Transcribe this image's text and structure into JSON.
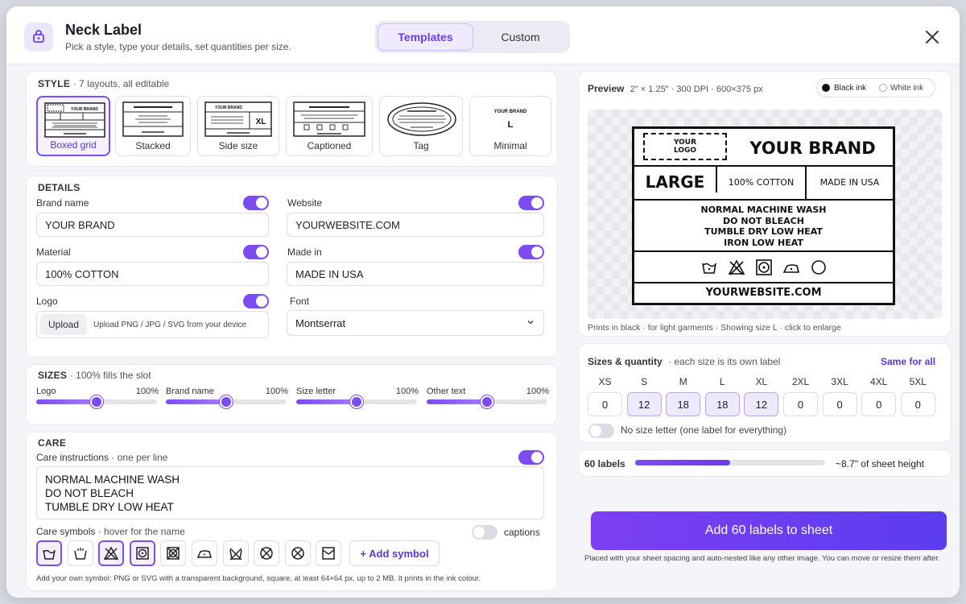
{
  "header": {
    "title": "Neck Label",
    "subtitle": "Pick a style, type your details, set quantities per size.",
    "tabs": [
      "Templates",
      "Custom"
    ],
    "active_tab": "Templates"
  },
  "style": {
    "title": "STYLE",
    "note": "· 7 layouts, all editable",
    "layouts": [
      "Boxed grid",
      "Stacked",
      "Side size",
      "Captioned",
      "Tag",
      "Minimal"
    ],
    "selected": "Boxed grid",
    "thumb_brand": "YOUR BRAND",
    "thumb_size": "XL",
    "thumb_minimal_size": "L"
  },
  "details": {
    "title": "DETAILS",
    "brand_label": "Brand name",
    "brand_value": "YOUR BRAND",
    "website_label": "Website",
    "website_value": "YOURWEBSITE.COM",
    "material_label": "Material",
    "material_value": "100% COTTON",
    "made_in_label": "Made in",
    "made_in_value": "MADE IN USA",
    "logo_label": "Logo",
    "upload_button": "Upload",
    "upload_hint": "Upload PNG / JPG / SVG from your device",
    "font_label": "Font",
    "font_value": "Montserrat",
    "toggles_on": true
  },
  "sizes": {
    "title": "SIZES",
    "note": "· 100% fills the slot",
    "sliders": [
      {
        "label": "Logo",
        "value": "100%",
        "level": 0.5
      },
      {
        "label": "Brand name",
        "value": "100%",
        "level": 0.5
      },
      {
        "label": "Size letter",
        "value": "100%",
        "level": 0.5
      },
      {
        "label": "Other text",
        "value": "100%",
        "level": 0.5
      }
    ]
  },
  "care": {
    "title": "CARE",
    "instructions_label": "Care instructions",
    "instructions_note": "· one per line",
    "instructions": [
      "NORMAL MACHINE WASH",
      "DO NOT BLEACH",
      "TUMBLE DRY LOW HEAT"
    ],
    "symbols_label": "Care symbols",
    "symbols_note": "· hover for the name",
    "captions_label": "captions",
    "add_symbol": "+ Add symbol",
    "hint": "Add your own symbol: PNG or SVG with a transparent background, square, at least 64×64 px, up to 2 MB. It prints in the ink colour.",
    "symbols": [
      {
        "icon": "wash-tub-icon",
        "selected": true
      },
      {
        "icon": "wash-tub-hand-icon",
        "selected": false
      },
      {
        "icon": "do-not-bleach-icon",
        "selected": true
      },
      {
        "icon": "tumble-dry-icon",
        "selected": true
      },
      {
        "icon": "do-not-tumble-dry-icon",
        "selected": false
      },
      {
        "icon": "iron-icon",
        "selected": false
      },
      {
        "icon": "do-not-wash-icon",
        "selected": false
      },
      {
        "icon": "do-not-dry-clean-icon",
        "selected": false
      },
      {
        "icon": "do-not-wring-icon",
        "selected": false
      },
      {
        "icon": "dry-flat-icon",
        "selected": false
      }
    ]
  },
  "preview": {
    "title": "Preview",
    "meta": "2\" × 1.25\" · 300 DPI · 600×375 px",
    "ink_black": "Black ink",
    "ink_white": "White ink",
    "ink_selected": "Black ink",
    "footer": "Prints in black · for light garments · Showing size L · click to enlarge",
    "label": {
      "logo": [
        "YOUR",
        "LOGO"
      ],
      "brand": "YOUR BRAND",
      "size": "LARGE",
      "material": "100% COTTON",
      "made_in": "MADE IN USA",
      "care": [
        "NORMAL MACHINE WASH",
        "DO NOT BLEACH",
        "TUMBLE DRY LOW HEAT",
        "IRON LOW HEAT"
      ],
      "website": "YOURWEBSITE.COM"
    }
  },
  "quantity": {
    "title": "Sizes & quantity",
    "note": "· each size is its own label",
    "same_for_all": "Same for all",
    "sizes": [
      {
        "size": "XS",
        "qty": "0"
      },
      {
        "size": "S",
        "qty": "12"
      },
      {
        "size": "M",
        "qty": "18"
      },
      {
        "size": "L",
        "qty": "18"
      },
      {
        "size": "XL",
        "qty": "12"
      },
      {
        "size": "2XL",
        "qty": "0"
      },
      {
        "size": "3XL",
        "qty": "0"
      },
      {
        "size": "4XL",
        "qty": "0"
      },
      {
        "size": "5XL",
        "qty": "0"
      }
    ],
    "no_size_label": "No size letter (one label for everything)"
  },
  "summary": {
    "labels": "60 labels",
    "sheet_height": "~8.7\" of sheet height",
    "progress": 0.5
  },
  "cta": {
    "label": "Add 60 labels to sheet",
    "note": "Placed with your sheet spacing and auto-nested like any other image. You can move or resize them after."
  },
  "colors": {
    "accent": "#7c4bf2",
    "accent_light": "#efeaff"
  }
}
